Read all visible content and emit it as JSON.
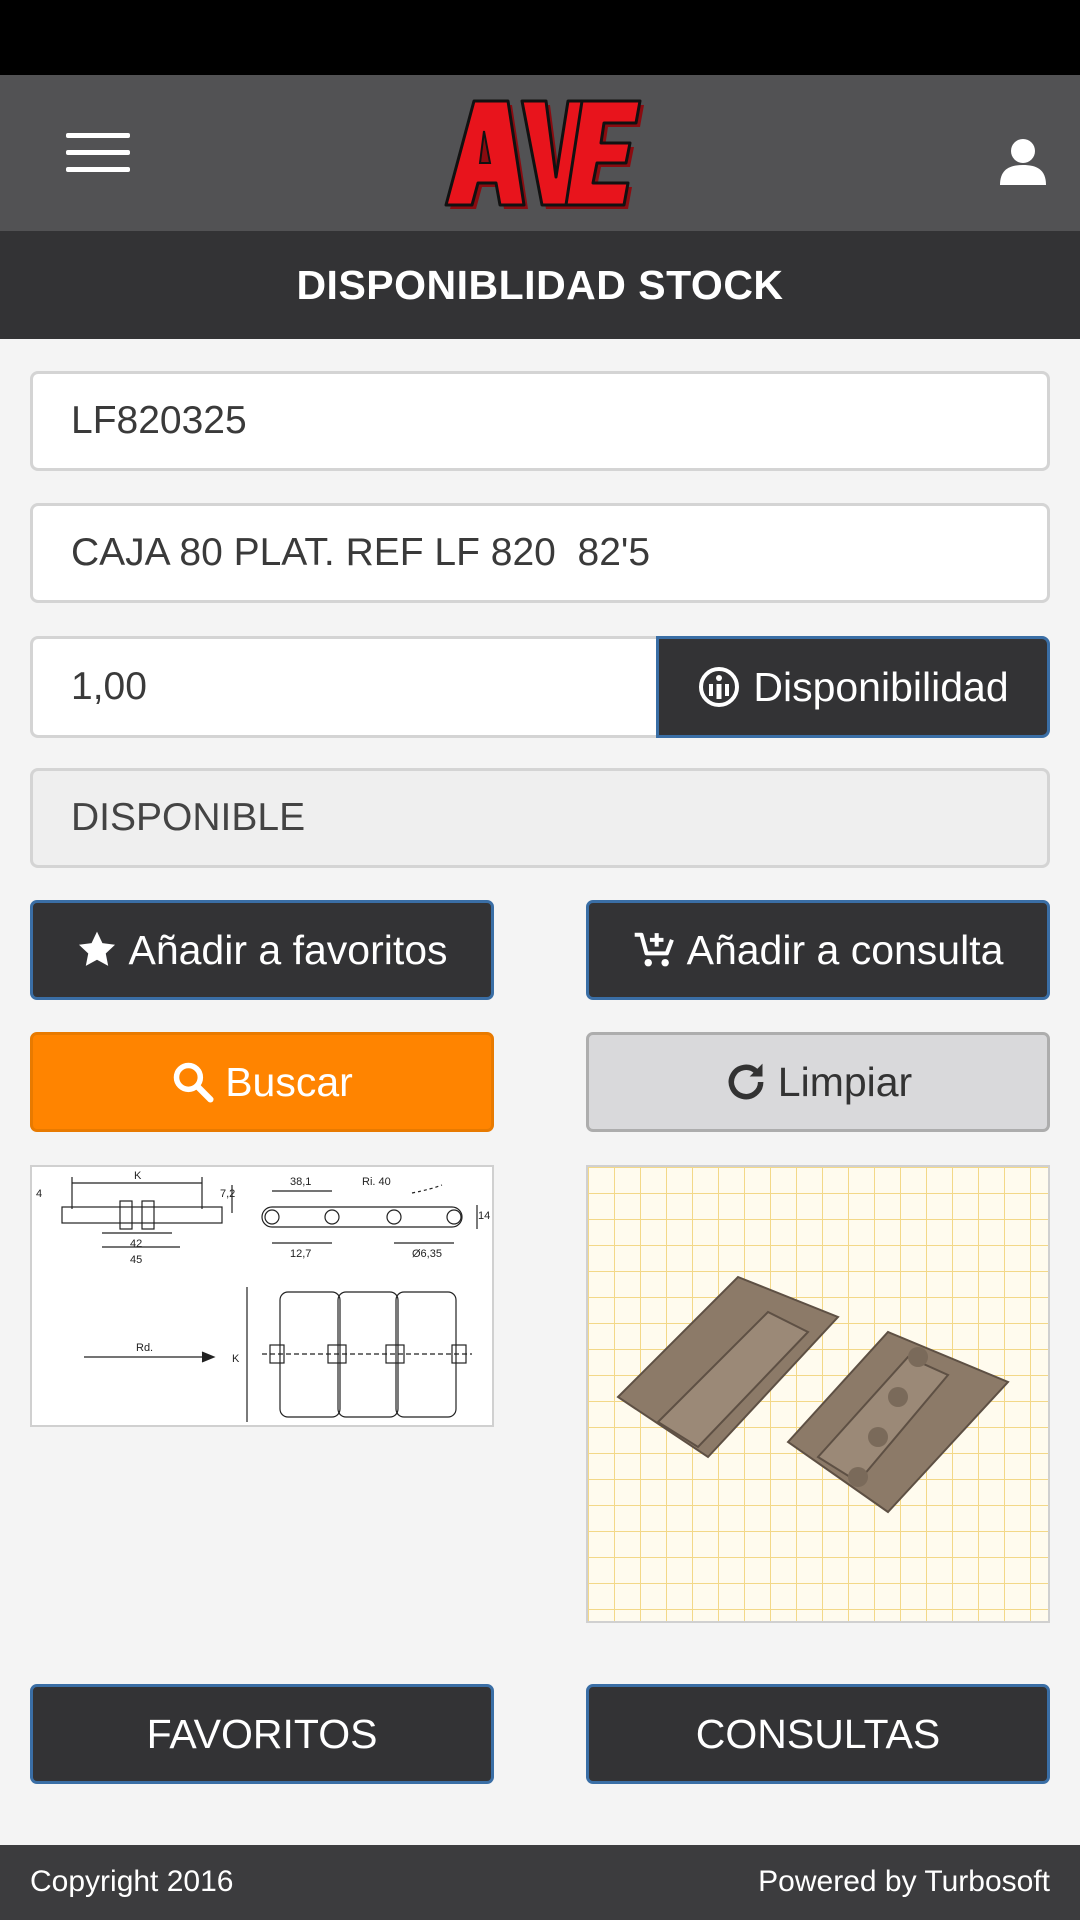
{
  "header": {
    "logo_text": "AVE",
    "menu_icon": "hamburger-menu-icon",
    "user_icon": "user-icon"
  },
  "page_title": "DISPONIBLIDAD STOCK",
  "form": {
    "reference": "LF820325",
    "description": "CAJA 80 PLAT. REF LF 820  82'5",
    "quantity": "1,00",
    "availability_button": "Disponibilidad",
    "status": "DISPONIBLE"
  },
  "actions": {
    "add_favorites": "Añadir a favoritos",
    "add_query": "Añadir a consulta",
    "search": "Buscar",
    "clear": "Limpiar"
  },
  "drawing_labels": {
    "k": "K",
    "v4": "4",
    "v72": "7,2",
    "v381": "38,1",
    "ri40": "Ri. 40",
    "v14": "14",
    "v42": "42",
    "v45": "45",
    "v127": "12,7",
    "v635": "Ø6,35",
    "rd": "Rd.",
    "k2": "K"
  },
  "bottom_nav": {
    "favorites": "FAVORITOS",
    "queries": "CONSULTAS"
  },
  "footer": {
    "copyright": "Copyright 2016",
    "powered": "Powered by Turbosoft"
  },
  "colors": {
    "header_bg": "#525254",
    "title_bg": "#333335",
    "button_dark": "#333335",
    "button_border": "#3a6ea5",
    "accent_orange": "#ff8400",
    "logo_red": "#e8141c"
  }
}
